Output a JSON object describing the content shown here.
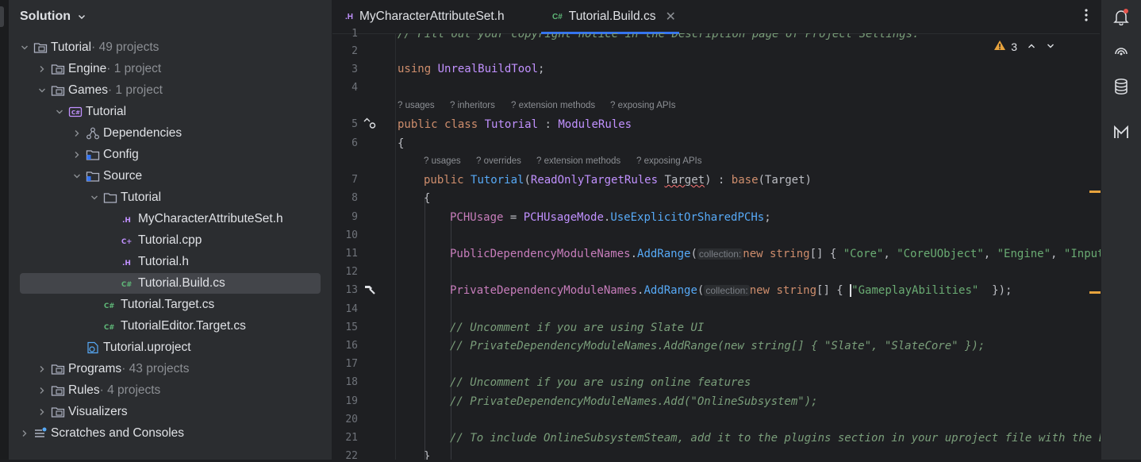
{
  "sidebar": {
    "title": "Solution",
    "tree": [
      {
        "label": "Tutorial",
        "sub": " · 49 projects",
        "icon": "solution-icon"
      },
      {
        "label": "Engine",
        "sub": " · 1 project",
        "icon": "folder-project-icon"
      },
      {
        "label": "Games",
        "sub": " · 1 project",
        "icon": "folder-project-icon"
      },
      {
        "label": "Tutorial",
        "sub": "",
        "icon": "csharp-project-icon"
      },
      {
        "label": "Dependencies",
        "sub": "",
        "icon": "dependencies-icon"
      },
      {
        "label": "Config",
        "sub": "",
        "icon": "folder-icon"
      },
      {
        "label": "Source",
        "sub": "",
        "icon": "folder-icon"
      },
      {
        "label": "Tutorial",
        "sub": "",
        "icon": "folder-icon"
      },
      {
        "label": "MyCharacterAttributeSet.h",
        "sub": "",
        "icon": "header-file-icon"
      },
      {
        "label": "Tutorial.cpp",
        "sub": "",
        "icon": "cpp-file-icon"
      },
      {
        "label": "Tutorial.h",
        "sub": "",
        "icon": "header-file-icon"
      },
      {
        "label": "Tutorial.Build.cs",
        "sub": "",
        "icon": "csharp-file-icon"
      },
      {
        "label": "Tutorial.Target.cs",
        "sub": "",
        "icon": "csharp-file-icon"
      },
      {
        "label": "TutorialEditor.Target.cs",
        "sub": "",
        "icon": "csharp-file-icon"
      },
      {
        "label": "Tutorial.uproject",
        "sub": "",
        "icon": "uproject-file-icon"
      },
      {
        "label": "Programs",
        "sub": " · 43 projects",
        "icon": "folder-project-icon"
      },
      {
        "label": "Rules",
        "sub": " · 4 projects",
        "icon": "folder-project-icon"
      },
      {
        "label": "Visualizers",
        "sub": "",
        "icon": "folder-project-icon"
      },
      {
        "label": "Scratches and Consoles",
        "sub": "",
        "icon": "scratches-icon"
      }
    ]
  },
  "tabs": [
    {
      "icon_text": ".H",
      "label": "MyCharacterAttributeSet.h"
    },
    {
      "icon_text": "C#",
      "label": "Tutorial.Build.cs"
    }
  ],
  "editor": {
    "warning_count": "3",
    "line_numbers": [
      "1",
      "2",
      "3",
      "4",
      "5",
      "6",
      "7",
      "8",
      "9",
      "10",
      "11",
      "12",
      "13",
      "14",
      "15",
      "16",
      "17",
      "18",
      "19",
      "20",
      "21",
      "22"
    ],
    "hints_class": [
      "usages",
      "inheritors",
      "extension methods",
      "exposing APIs"
    ],
    "hints_ctor": [
      "usages",
      "overrides",
      "extension methods",
      "exposing APIs"
    ],
    "param_hint": "collection:",
    "code": {
      "l1": "// Fill out your copyright notice in the Description page of Project Settings.",
      "l3a": "using",
      "l3b": "UnrealBuildTool",
      "l3c": ";",
      "l5a": "public",
      "l5b": "class",
      "l5c": "Tutorial",
      "l5d": " : ",
      "l5e": "ModuleRules",
      "l6": "{",
      "l7a": "public",
      "l7b": "Tutorial",
      "l7c": "(",
      "l7d": "ReadOnlyTargetRules",
      "l7e": "Target",
      "l7f": ") : ",
      "l7g": "base",
      "l7h": "(Target)",
      "l8": "{",
      "l9a": "PCHUsage",
      "l9b": " = ",
      "l9c": "PCHUsageMode",
      "l9d": ".",
      "l9e": "UseExplicitOrSharedPCHs",
      "l9f": ";",
      "l11a": "PublicDependencyModuleNames",
      "l11b": ".",
      "l11c": "AddRange",
      "l11d": "(",
      "l11e": "new",
      "l11f": "string",
      "l11g": "[] { ",
      "l11h": "\"Core\"",
      "l11i": ", ",
      "l11j": "\"CoreUObject\"",
      "l11k": ", ",
      "l11l": "\"Engine\"",
      "l11m": ", ",
      "l11n": "\"InputC",
      "l13a": "PrivateDependencyModuleNames",
      "l13b": ".",
      "l13c": "AddRange",
      "l13d": "(",
      "l13e": "new",
      "l13f": "string",
      "l13g": "[] { ",
      "l13h": "\"GameplayAbilities\"",
      "l13i": "  });",
      "l15": "// Uncomment if you are using Slate UI",
      "l16": "// PrivateDependencyModuleNames.AddRange(new string[] { \"Slate\", \"SlateCore\" });",
      "l18": "// Uncomment if you are using online features",
      "l19": "// PrivateDependencyModuleNames.Add(\"OnlineSubsystem\");",
      "l21": "// To include OnlineSubsystemSteam, add it to the plugins section in your uproject file with the End",
      "l22": "}"
    }
  },
  "colors": {
    "accent": "#3574f0",
    "warning": "#e8a33d",
    "notification_dot": "#e5534b"
  }
}
